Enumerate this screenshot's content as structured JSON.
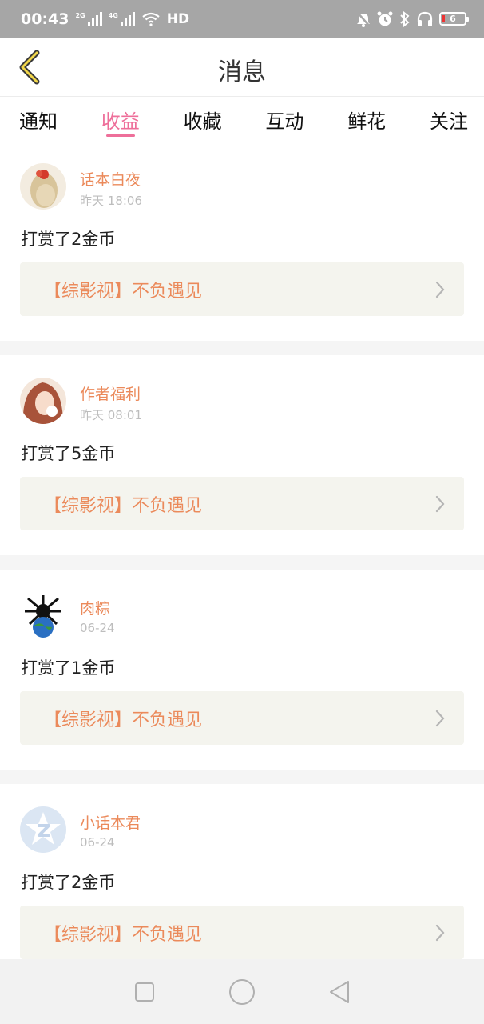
{
  "status_bar": {
    "time": "00:43",
    "net1": "2G",
    "net2": "4G",
    "hd": "HD",
    "battery": "6"
  },
  "header": {
    "title": "消息",
    "back_icon": "chevron-left-icon"
  },
  "tabs": [
    {
      "label": "通知",
      "active": false
    },
    {
      "label": "收益",
      "active": true
    },
    {
      "label": "收藏",
      "active": false
    },
    {
      "label": "互动",
      "active": false
    },
    {
      "label": "鲜花",
      "active": false
    },
    {
      "label": "关注",
      "active": false
    }
  ],
  "messages": [
    {
      "name": "话本白夜",
      "time": "昨天 18:06",
      "text": "打赏了2金币",
      "book": "【综影视】不负遇见"
    },
    {
      "name": "作者福利",
      "time": "昨天 08:01",
      "text": "打赏了5金币",
      "book": "【综影视】不负遇见"
    },
    {
      "name": "肉粽",
      "time": "06-24",
      "text": "打赏了1金币",
      "book": "【综影视】不负遇见"
    },
    {
      "name": "小话本君",
      "time": "06-24",
      "text": "打赏了2金币",
      "book": "【综影视】不负遇见"
    }
  ],
  "colors": {
    "accent": "#ee6f9a",
    "name": "#eb8a5b",
    "status_bar": "#a6a6a6"
  },
  "nav": [
    "square-icon",
    "circle-icon",
    "triangle-back-icon"
  ]
}
